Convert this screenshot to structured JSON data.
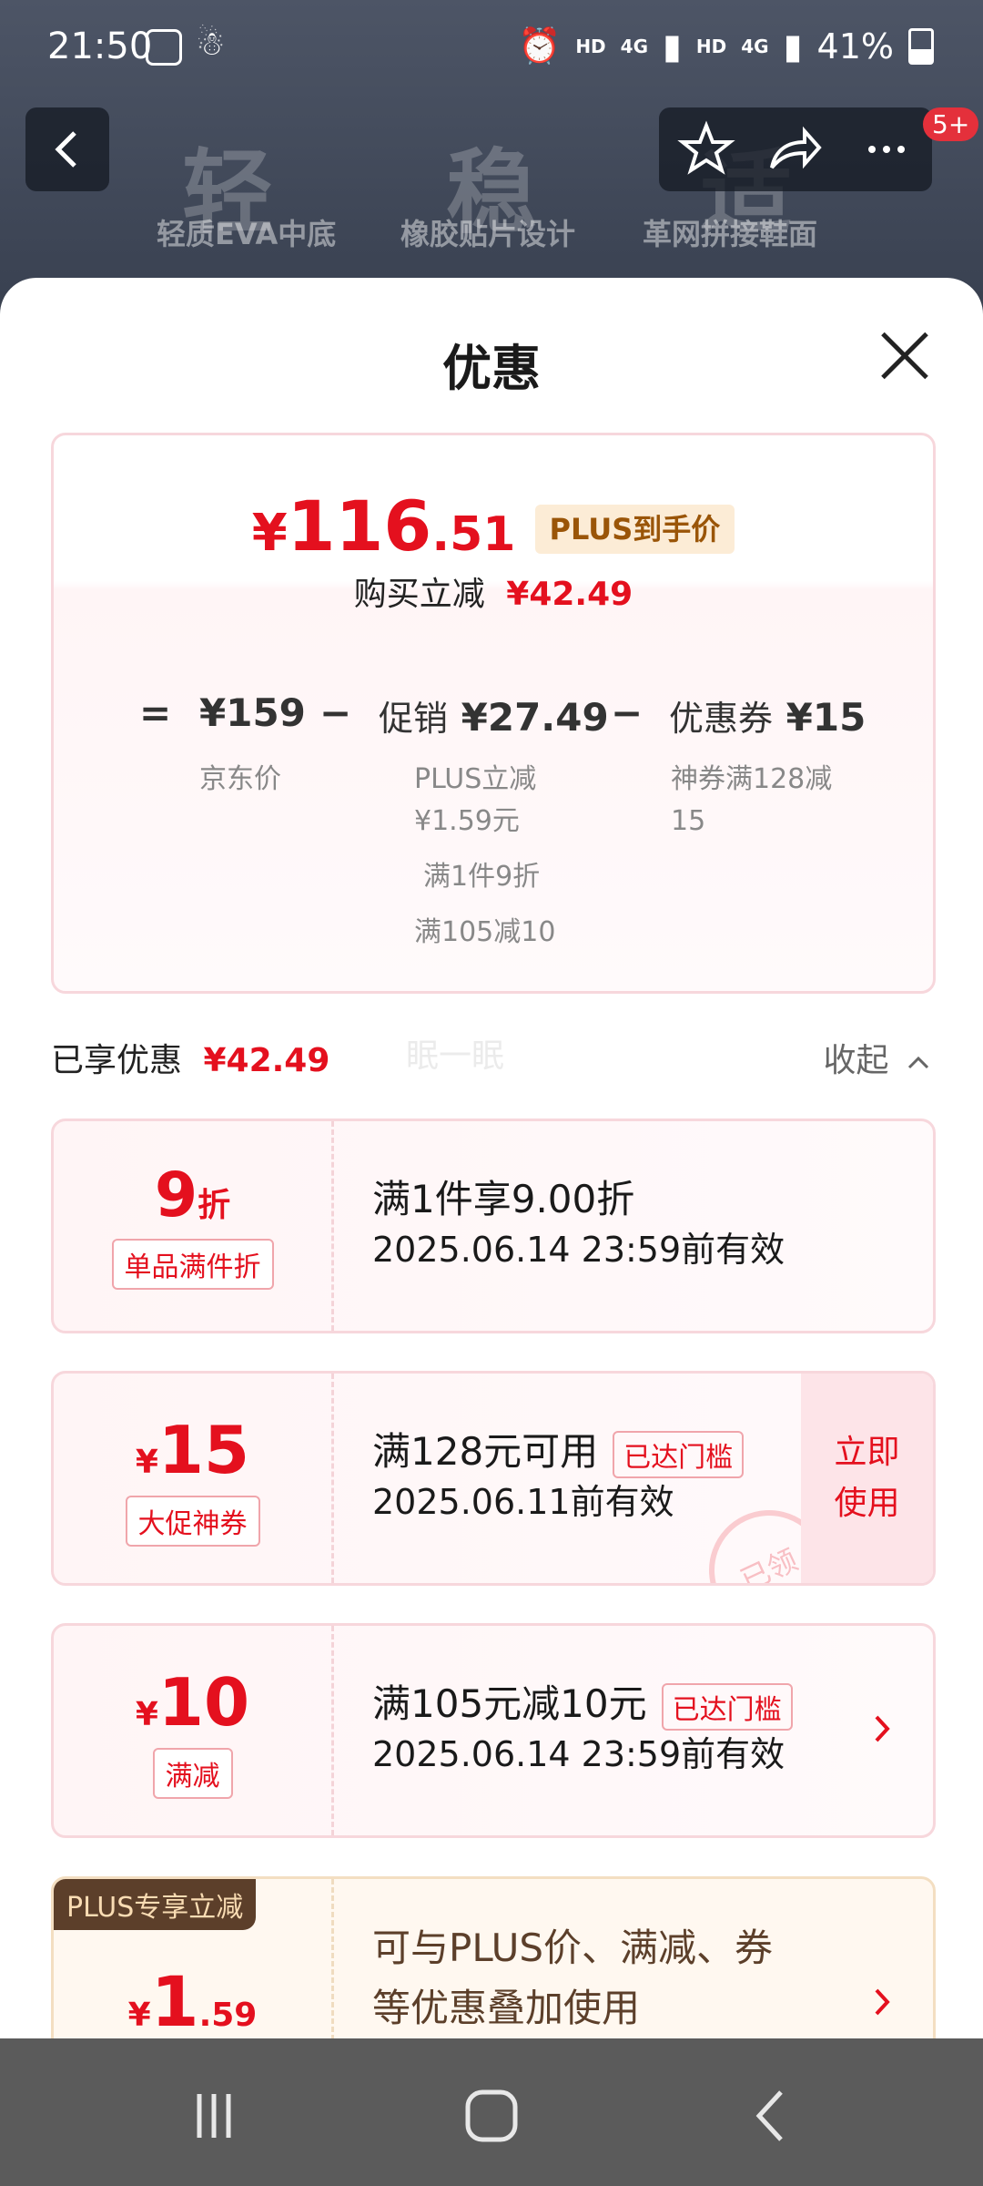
{
  "status_bar": {
    "time": "21:50",
    "network_1": "HD",
    "signal_1": "4G",
    "network_2": "HD",
    "signal_2": "4G",
    "battery": "41%"
  },
  "background_page": {
    "features": [
      {
        "big": "轻",
        "label": "轻质EVA中底"
      },
      {
        "big": "稳",
        "label": "橡胶贴片设计"
      },
      {
        "big": "适",
        "label": "革网拼接鞋面"
      }
    ],
    "message_badge": "5+",
    "faint_text": "眠一眠"
  },
  "sheet": {
    "title": "优惠",
    "summary": {
      "currency": "¥",
      "price_int": "116",
      "price_dec": ".51",
      "price_tag": "PLUS到手价",
      "instant_label": "购买立减",
      "instant_value": "¥42.49",
      "eq": "=",
      "minus": "−",
      "jd_price": "¥159",
      "jd_label": "京东价",
      "promo_label": "促销",
      "promo_value": "¥27.49",
      "promo_details": [
        "PLUS立减",
        "¥1.59元",
        "满1件9折",
        "满105减10"
      ],
      "coupon_label": "优惠券",
      "coupon_value": "¥15",
      "coupon_details": [
        "神券满128减",
        "15"
      ]
    },
    "enjoyed_label": "已享优惠",
    "enjoyed_value": "¥42.49",
    "collapse_label": "收起",
    "coupons": [
      {
        "big": "9",
        "unit": "折",
        "tag": "单品满件折",
        "line1": "满1件享9.00折",
        "line2": "2025.06.14 23:59前有效"
      },
      {
        "currency": "¥",
        "big": "15",
        "tag": "大促神券",
        "line1": "满128元可用",
        "badge": "已达门槛",
        "line2": "2025.06.11前有效",
        "action": "立即使用",
        "action_l1": "立即",
        "action_l2": "使用",
        "stamp": "已领"
      },
      {
        "currency": "¥",
        "big": "10",
        "tag": "满减",
        "line1": "满105元减10元",
        "badge": "已达门槛",
        "line2": "2025.06.14 23:59前有效"
      }
    ],
    "plus_card": {
      "corner": "PLUS专享立减",
      "currency": "¥",
      "big": "1",
      "dec": ".59",
      "line1": "可与PLUS价、满减、券",
      "line2": "等优惠叠加使用"
    }
  },
  "colors": {
    "accent": "#e4101e",
    "plus_brown": "#5c3f2a"
  }
}
